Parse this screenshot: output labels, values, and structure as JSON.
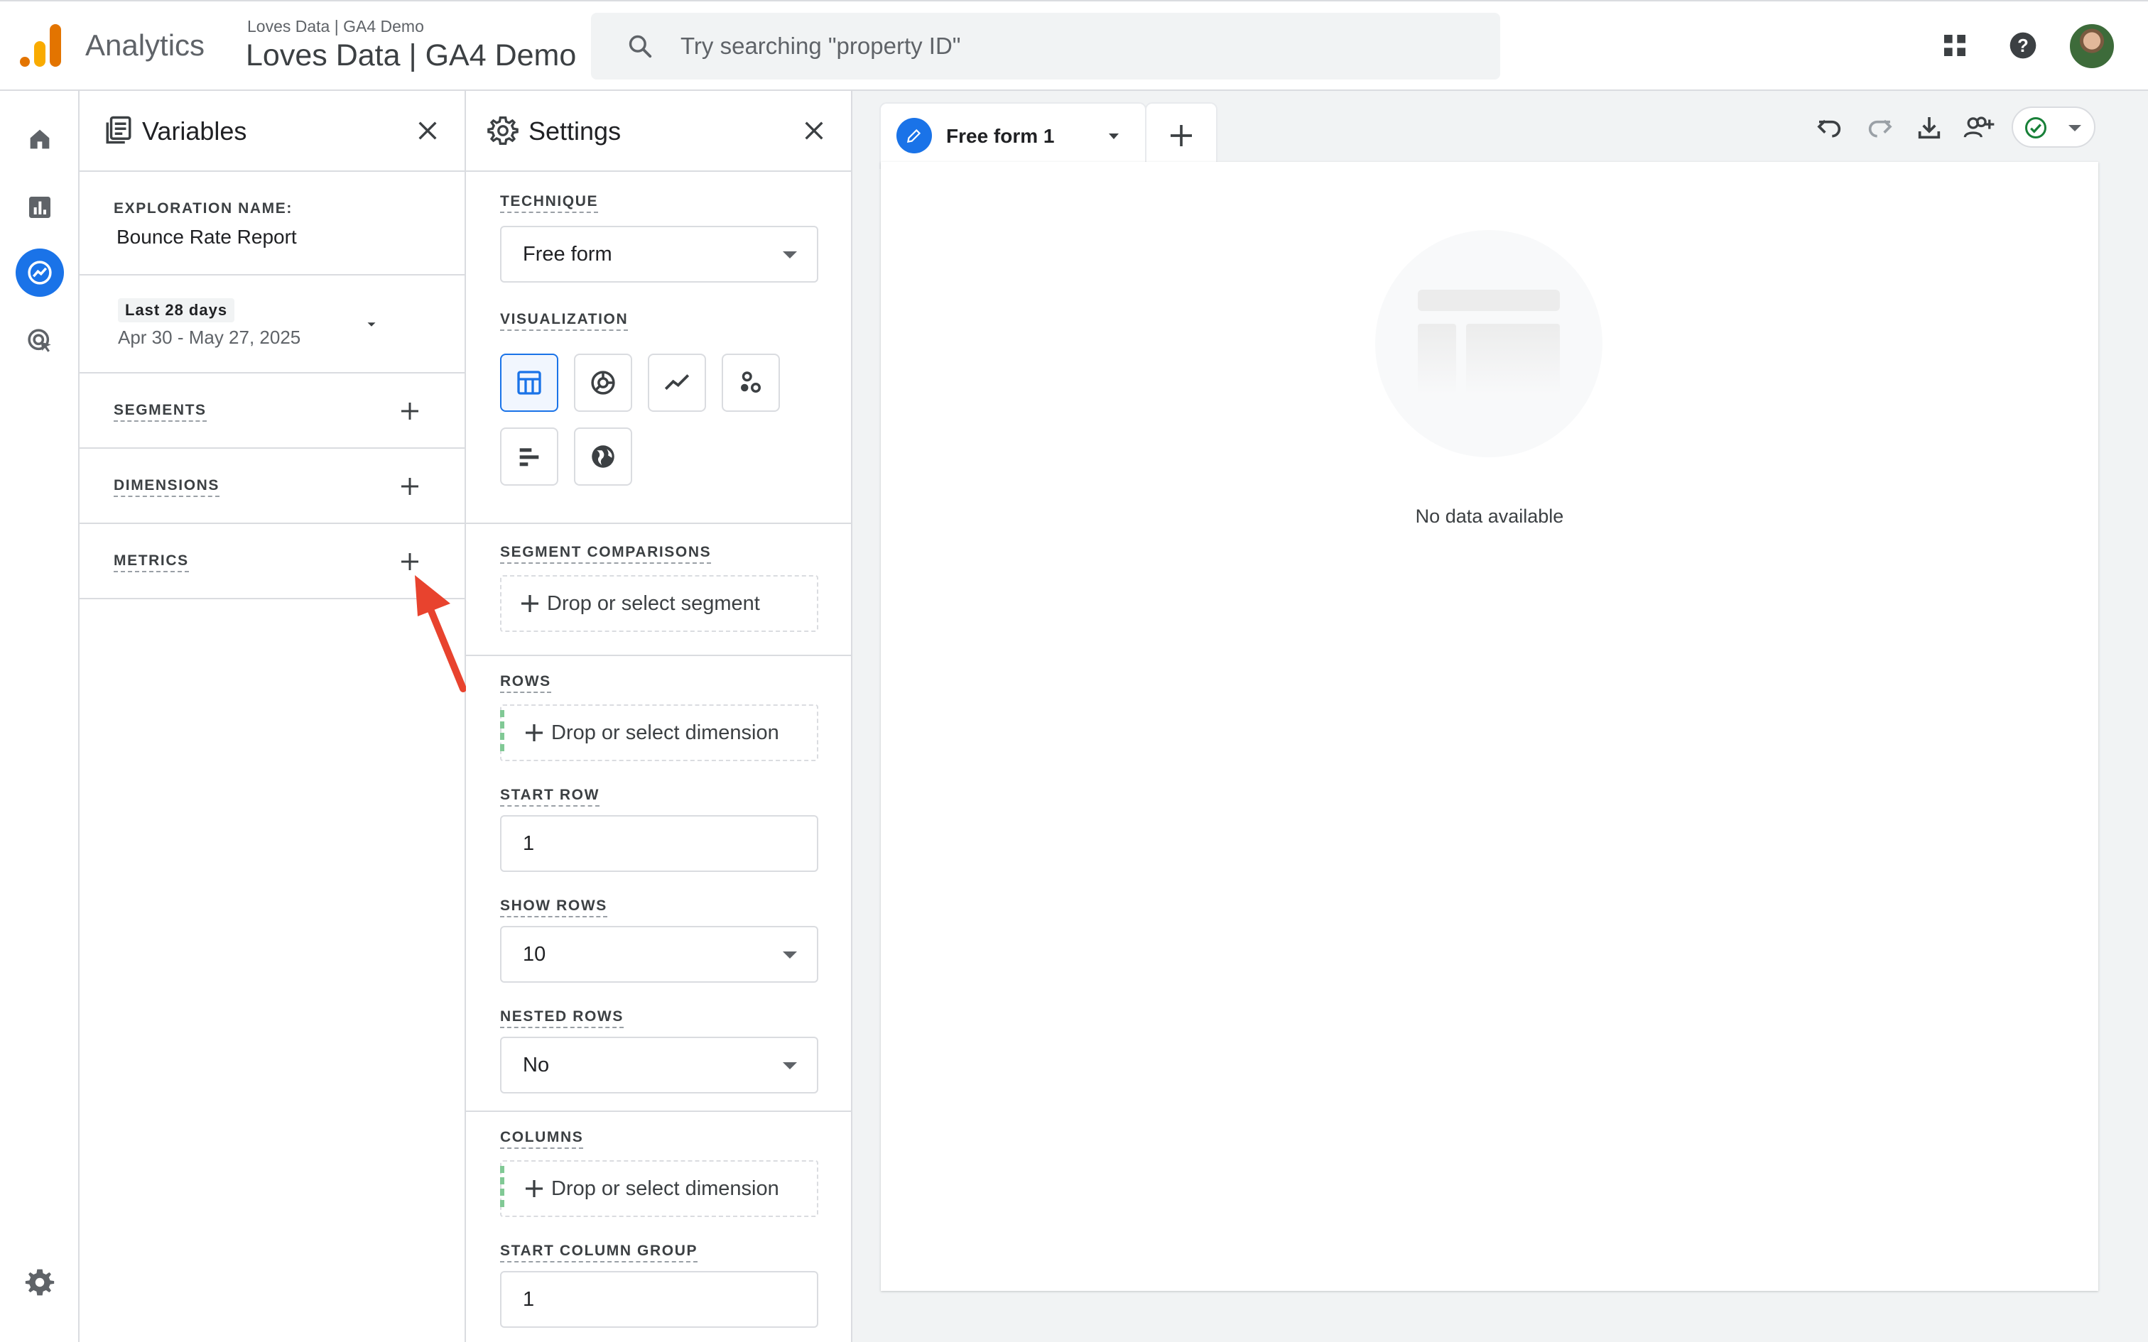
{
  "header": {
    "app_name": "Analytics",
    "account_path": "Loves Data | GA4 Demo",
    "property_name": "Loves Data | GA4 Demo",
    "search_placeholder": "Try searching \"property ID\""
  },
  "left_nav": {
    "items": [
      {
        "icon": "home-icon"
      },
      {
        "icon": "reports-icon"
      },
      {
        "icon": "explore-icon",
        "active": true
      },
      {
        "icon": "advertising-icon"
      }
    ],
    "bottom_icon": "settings-gear-icon"
  },
  "variables": {
    "title": "Variables",
    "exploration_name_label": "EXPLORATION NAME:",
    "exploration_name": "Bounce Rate Report",
    "date_preset": "Last 28 days",
    "date_range": "Apr 30 - May 27, 2025",
    "sections": [
      {
        "label": "SEGMENTS"
      },
      {
        "label": "DIMENSIONS"
      },
      {
        "label": "METRICS"
      }
    ]
  },
  "settings": {
    "title": "Settings",
    "technique_label": "TECHNIQUE",
    "technique_value": "Free form",
    "visualization_label": "VISUALIZATION",
    "visualizations": [
      "table-icon",
      "donut-chart-icon",
      "line-chart-icon",
      "scatter-plot-icon",
      "bar-chart-icon",
      "geo-map-icon"
    ],
    "segment_comparisons_label": "SEGMENT COMPARISONS",
    "segment_drop_text": "Drop or select segment",
    "rows_label": "ROWS",
    "rows_drop_text": "Drop or select dimension",
    "start_row_label": "START ROW",
    "start_row_value": "1",
    "show_rows_label": "SHOW ROWS",
    "show_rows_value": "10",
    "nested_rows_label": "NESTED ROWS",
    "nested_rows_value": "No",
    "columns_label": "COLUMNS",
    "columns_drop_text": "Drop or select dimension",
    "start_column_group_label": "START COLUMN GROUP",
    "start_column_group_value": "1"
  },
  "canvas": {
    "tab_label": "Free form 1",
    "empty_message": "No data available"
  },
  "colors": {
    "accent": "#1a73e8",
    "annotation_arrow": "#e8432e",
    "ga_orange": "#e37400",
    "ga_yellow": "#f9ab00"
  }
}
